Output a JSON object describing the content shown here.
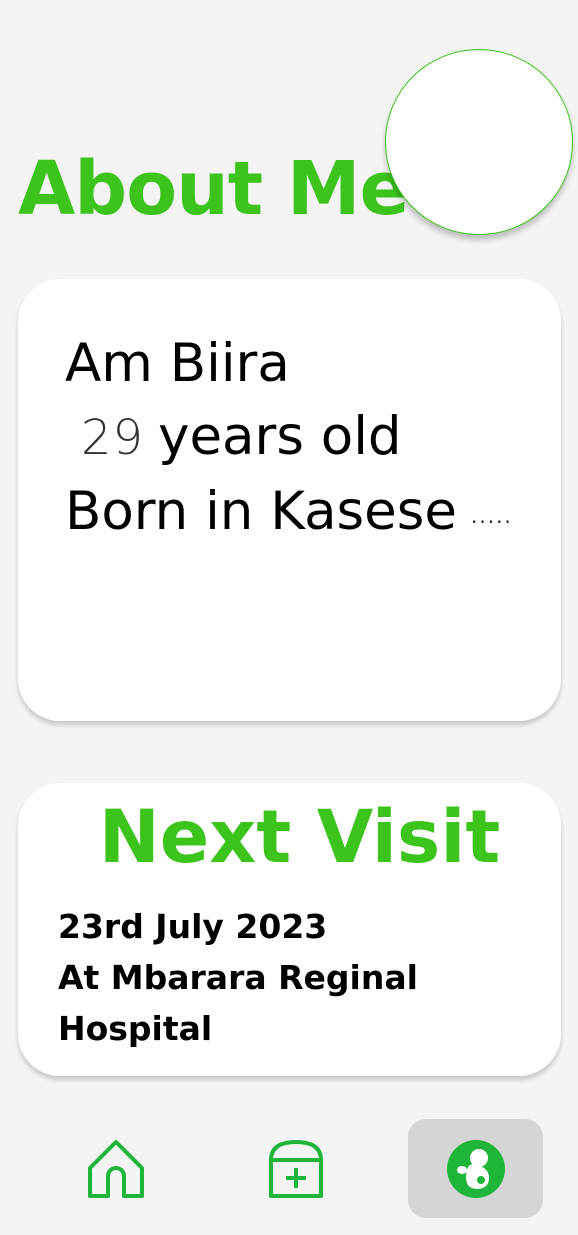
{
  "header": {
    "title": "About Me"
  },
  "about": {
    "name_line": "Am Biira",
    "age": "29",
    "age_suffix": "years old",
    "birthplace_line": "Born in Kasese",
    "ellipsis": "....."
  },
  "next_visit": {
    "heading": "Next Visit",
    "date": "23rd July 2023",
    "location_line1": "At Mbarara Reginal",
    "location_line2": "Hospital"
  },
  "bottom_nav": {
    "items": [
      {
        "icon": "home-icon",
        "active": false
      },
      {
        "icon": "medical-bag-icon",
        "active": false
      },
      {
        "icon": "baby-fetus-icon",
        "active": true
      }
    ]
  },
  "colors": {
    "accent": "#3cc41c",
    "nav_active_bg": "#d5d5d5",
    "background": "#f4f4f4"
  }
}
